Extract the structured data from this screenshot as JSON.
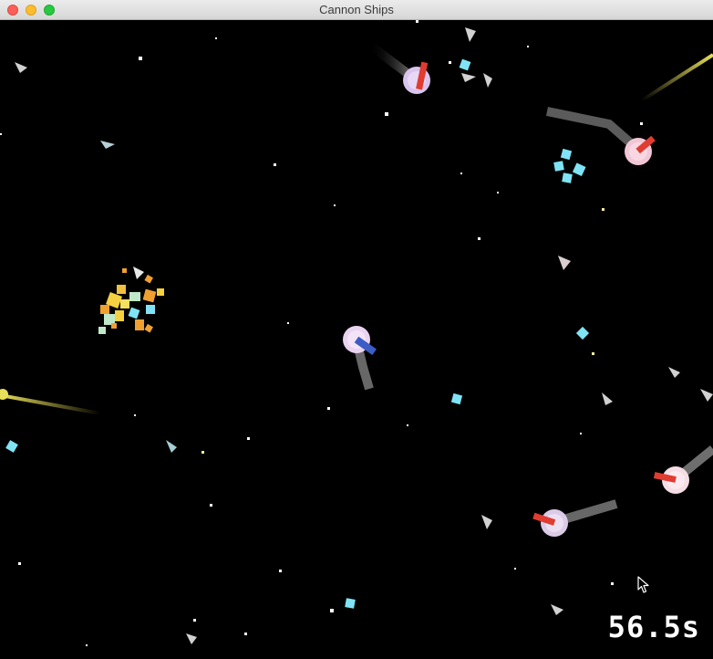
{
  "window": {
    "title": "Cannon Ships"
  },
  "hud": {
    "timer": "56.5s"
  },
  "icons": [
    "close-icon",
    "minimize-icon",
    "maximize-icon",
    "arrow-cursor-icon"
  ],
  "colors": {
    "background": "#000000",
    "enemy_cannon": "#e03c31",
    "player_cannon": "#3b5cc4",
    "ship_body": "#e9d3f0",
    "trail": "#8a8a8a",
    "shot_trail": "#e8df5a",
    "crystal": "#7fe3f5",
    "debris": "#f0a030"
  }
}
